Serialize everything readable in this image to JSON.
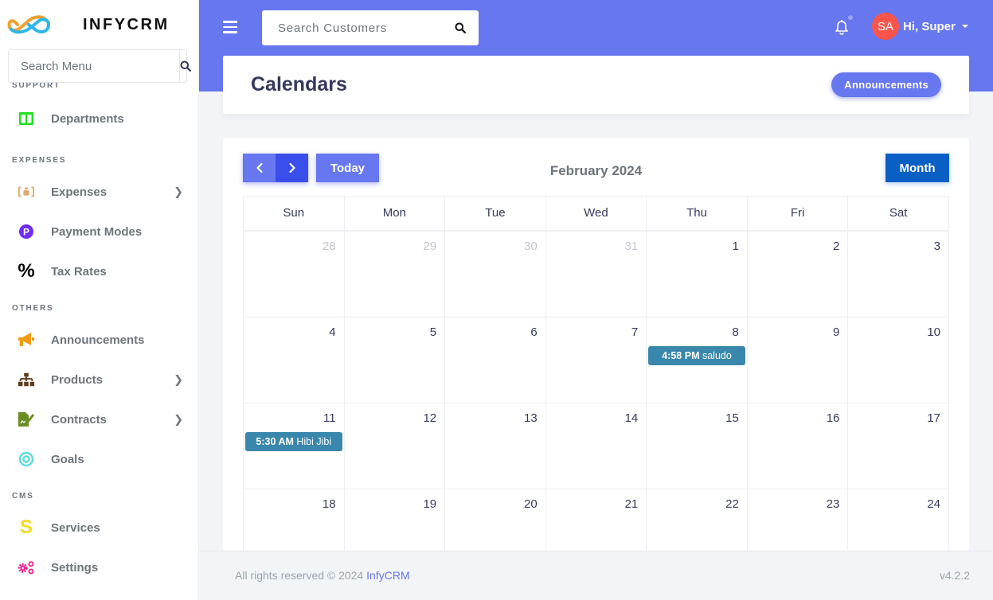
{
  "brand": {
    "name": "INFYCRM",
    "logo_icon": "infinity-logo-icon"
  },
  "sidebar": {
    "search_placeholder": "Search Menu",
    "sections": [
      {
        "title": "SUPPORT",
        "items": [
          {
            "label": "Departments",
            "icon": "departments-icon",
            "color": "#1ee01e",
            "has_submenu": false
          }
        ]
      },
      {
        "title": "EXPENSES",
        "items": [
          {
            "label": "Expenses",
            "icon": "expenses-icon",
            "color": "#e0a76a",
            "has_submenu": true
          },
          {
            "label": "Payment Modes",
            "icon": "payment-p-icon",
            "color": "#6f2cf5",
            "has_submenu": false
          },
          {
            "label": "Tax Rates",
            "icon": "percent-icon",
            "color": "#000000",
            "has_submenu": false
          }
        ]
      },
      {
        "title": "OTHERS",
        "items": [
          {
            "label": "Announcements",
            "icon": "bullhorn-icon",
            "color": "#f39c12",
            "has_submenu": false
          },
          {
            "label": "Products",
            "icon": "sitemap-icon",
            "color": "#5d3a1a",
            "has_submenu": true
          },
          {
            "label": "Contracts",
            "icon": "file-signature-icon",
            "color": "#6b8e23",
            "has_submenu": true
          },
          {
            "label": "Goals",
            "icon": "bullseye-icon",
            "color": "#5ddcdc",
            "has_submenu": false
          }
        ]
      },
      {
        "title": "CMS",
        "items": [
          {
            "label": "Services",
            "icon": "services-s-icon",
            "color": "#f1dc1e",
            "has_submenu": false
          },
          {
            "label": "Settings",
            "icon": "cogs-icon",
            "color": "#ef1d8c",
            "has_submenu": false
          }
        ]
      }
    ]
  },
  "topbar": {
    "search_placeholder": "Search Customers",
    "user_initials": "SA",
    "user_greeting": "Hi, Super",
    "accent": "#6777ef"
  },
  "header": {
    "title": "Calendars",
    "announcements_button": "Announcements"
  },
  "calendar": {
    "title": "February 2024",
    "today_label": "Today",
    "month_label": "Month",
    "prev_icon": "‹",
    "next_icon": "›",
    "weekdays": [
      "Sun",
      "Mon",
      "Tue",
      "Wed",
      "Thu",
      "Fri",
      "Sat"
    ],
    "weeks": [
      [
        {
          "day": "28",
          "other": true
        },
        {
          "day": "29",
          "other": true
        },
        {
          "day": "30",
          "other": true
        },
        {
          "day": "31",
          "other": true
        },
        {
          "day": "1"
        },
        {
          "day": "2"
        },
        {
          "day": "3"
        }
      ],
      [
        {
          "day": "4"
        },
        {
          "day": "5"
        },
        {
          "day": "6"
        },
        {
          "day": "7"
        },
        {
          "day": "8",
          "event": {
            "time": "4:58 PM",
            "title": "saludo"
          }
        },
        {
          "day": "9"
        },
        {
          "day": "10"
        }
      ],
      [
        {
          "day": "11",
          "event": {
            "time": "5:30 AM",
            "title": "Hibi Jibi"
          }
        },
        {
          "day": "12"
        },
        {
          "day": "13"
        },
        {
          "day": "14"
        },
        {
          "day": "15"
        },
        {
          "day": "16"
        },
        {
          "day": "17"
        }
      ],
      [
        {
          "day": "18"
        },
        {
          "day": "19"
        },
        {
          "day": "20"
        },
        {
          "day": "21"
        },
        {
          "day": "22"
        },
        {
          "day": "23"
        },
        {
          "day": "24"
        }
      ]
    ],
    "event_color": "#3a87ad"
  },
  "footer": {
    "copyright": "All rights reserved © 2024 ",
    "brand_link": "InfyCRM",
    "version": "v4.2.2"
  }
}
